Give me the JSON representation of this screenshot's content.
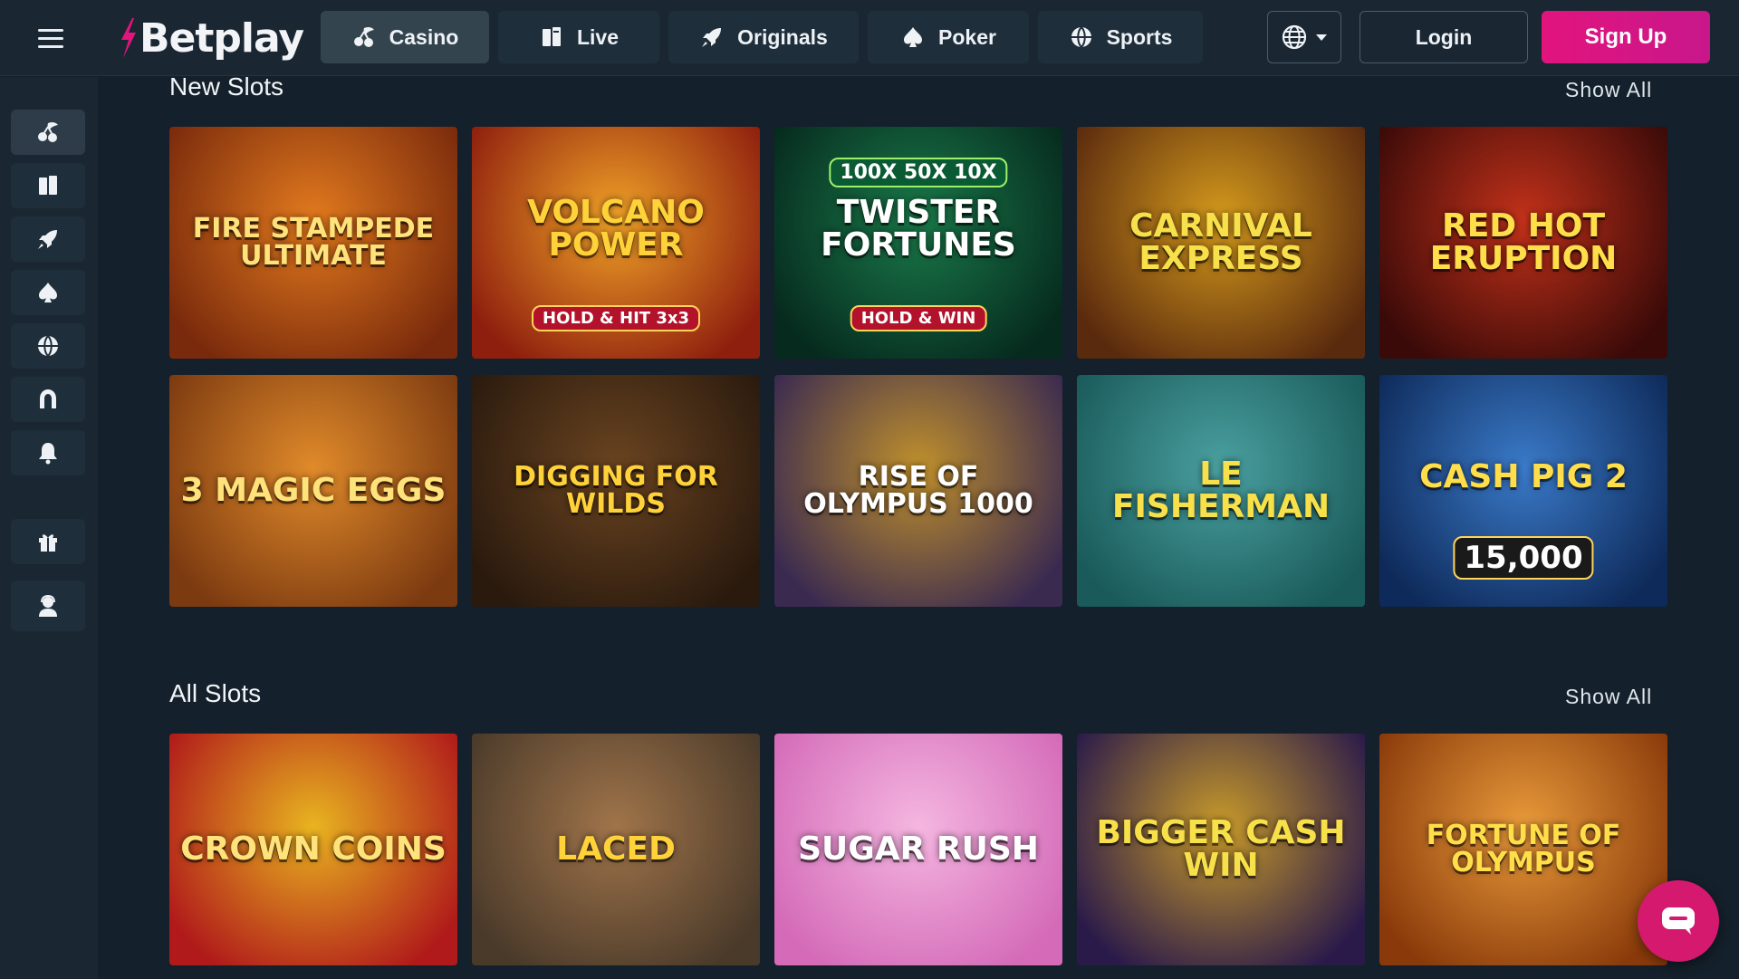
{
  "brand": {
    "name": "Betplay",
    "logo_text": "Betplay",
    "accent": "#e2147d"
  },
  "nav": {
    "tabs": [
      {
        "label": "Casino",
        "icon": "cherry-icon",
        "active": true
      },
      {
        "label": "Live",
        "icon": "card-icon",
        "active": false
      },
      {
        "label": "Originals",
        "icon": "rocket-icon",
        "active": false
      },
      {
        "label": "Poker",
        "icon": "spade-icon",
        "active": false
      },
      {
        "label": "Sports",
        "icon": "ball-icon",
        "active": false
      }
    ]
  },
  "header": {
    "language_icon": "globe-icon",
    "login_label": "Login",
    "signup_label": "Sign Up"
  },
  "sidebar": {
    "items": [
      {
        "icon": "cherry-icon",
        "active": true
      },
      {
        "icon": "card-icon",
        "active": false
      },
      {
        "icon": "rocket-icon",
        "active": false
      },
      {
        "icon": "spade-icon",
        "active": false
      },
      {
        "icon": "ball-icon",
        "active": false
      },
      {
        "icon": "horseshoe-icon",
        "active": false
      },
      {
        "icon": "bell-icon",
        "active": false
      },
      {
        "icon": "gift-icon",
        "active": false
      },
      {
        "icon": "user-support-icon",
        "active": false
      }
    ]
  },
  "sections": {
    "new_slots": {
      "title": "New Slots",
      "show_all": "Show All",
      "games": [
        {
          "title": "Fire Stampede Ultimate",
          "colors": [
            "#7a2a0c",
            "#e27a1e"
          ]
        },
        {
          "title": "Volcano Power",
          "badge": "HOLD & HIT 3x3",
          "colors": [
            "#8e1f0e",
            "#f0a227"
          ]
        },
        {
          "title": "Twister Fortunes",
          "badge": "HOLD & WIN",
          "top": "100X  50X  10X",
          "colors": [
            "#062a1e",
            "#1a7a4a"
          ]
        },
        {
          "title": "Carnival Express",
          "colors": [
            "#5a2a0e",
            "#d49a1c"
          ]
        },
        {
          "title": "Red Hot Eruption",
          "colors": [
            "#3a0a08",
            "#c2311a"
          ]
        },
        {
          "title": "3 Magic Eggs",
          "colors": [
            "#7c3a10",
            "#e08a2a"
          ]
        },
        {
          "title": "Digging for Wilds",
          "colors": [
            "#2a1a0e",
            "#6a4420"
          ]
        },
        {
          "title": "Rise of Olympus 1000",
          "colors": [
            "#3a2a50",
            "#c0902c"
          ]
        },
        {
          "title": "Le Fisherman",
          "colors": [
            "#1a5a5a",
            "#4aa0a0"
          ]
        },
        {
          "title": "Cash Pig 2",
          "badge": "15,000",
          "colors": [
            "#0e2a5a",
            "#3a7ac8"
          ]
        }
      ]
    },
    "all_slots": {
      "title": "All Slots",
      "show_all": "Show All",
      "games": [
        {
          "title": "Crown Coins",
          "colors": [
            "#b01a1a",
            "#e8b420"
          ]
        },
        {
          "title": "Laced",
          "colors": [
            "#4a3a2a",
            "#a0744a"
          ]
        },
        {
          "title": "Sugar Rush",
          "colors": [
            "#d46ab8",
            "#f4b6e0"
          ]
        },
        {
          "title": "Bigger Cash Win",
          "colors": [
            "#2a1a4a",
            "#c89a2a"
          ]
        },
        {
          "title": "Fortune of Olympus",
          "colors": [
            "#8a3a0a",
            "#e89a3a"
          ]
        }
      ]
    }
  },
  "chat": {
    "icon": "chat-icon"
  }
}
